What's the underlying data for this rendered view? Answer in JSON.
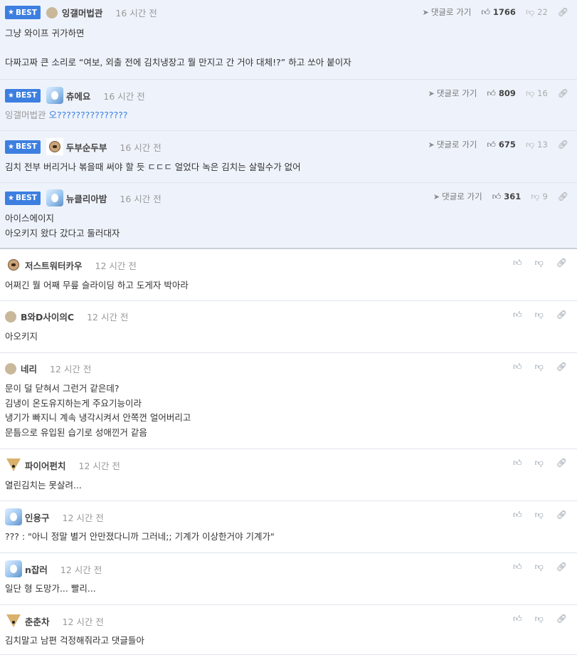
{
  "labels": {
    "best": "BEST",
    "goto": "댓글로 가기"
  },
  "best_comments": [
    {
      "nick": "잉갤머법관",
      "time": "16 시간 전",
      "likes": "1766",
      "dislikes": "22",
      "lines": [
        "그냥 와이프 귀가하면",
        "",
        "다짜고짜 큰 소리로 “여보, 외출 전에 김치냉장고 뭘 만지고 간 거야 대체!?” 하고 쏘아 붙이자"
      ]
    },
    {
      "nick": "츄에요",
      "time": "16 시간 전",
      "likes": "809",
      "dislikes": "16",
      "mention": "잉갤머법관",
      "reply": "오???????????????"
    },
    {
      "nick": "두부순두부",
      "time": "16 시간 전",
      "likes": "675",
      "dislikes": "13",
      "lines": [
        "김치 전부 버리거나 볶을때 써야 할 듯 ㄷㄷㄷ 얼었다 녹은 김치는 살릴수가 없어"
      ]
    },
    {
      "nick": "뉴클리아밤",
      "time": "16 시간 전",
      "likes": "361",
      "dislikes": "9",
      "lines": [
        "아이스에이지",
        "아오키지 왔다 갔다고 둘러대자"
      ]
    }
  ],
  "comments": [
    {
      "nick": "저스트워터카우",
      "time": "12 시간 전",
      "lines": [
        "어쩌긴 뭘 어째 무릎 슬라이딩 하고 도게자 박아라"
      ]
    },
    {
      "nick": "B와D사이의C",
      "time": "12 시간 전",
      "lines": [
        "아오키지"
      ]
    },
    {
      "nick": "네리",
      "time": "12 시간 전",
      "lines": [
        "문이 덜 닫혀서 그런거 같은데?",
        "김냉이 온도유지하는게 주요기능이라",
        "냉기가 빠지니 계속 냉각시켜서 안쪽껀 얼어버리고",
        "문틈으로 유입된 습기로 성애낀거 같음"
      ]
    },
    {
      "nick": "파이어펀치",
      "time": "12 시간 전",
      "lines": [
        "열린김치는 못살려..."
      ]
    },
    {
      "nick": "인용구",
      "time": "12 시간 전",
      "lines": [
        "??? : \"아니 정말 별거 안만졌다니까 그러네;; 기계가 이상한거야 기계가\""
      ]
    },
    {
      "nick": "n잡러",
      "time": "12 시간 전",
      "lines": [
        "일단 형 도망가... 빨리..."
      ]
    },
    {
      "nick": "춘춘차",
      "time": "12 시간 전",
      "lines": [
        "김치말고 남편 걱정해줘라고 댓글들아"
      ]
    }
  ]
}
